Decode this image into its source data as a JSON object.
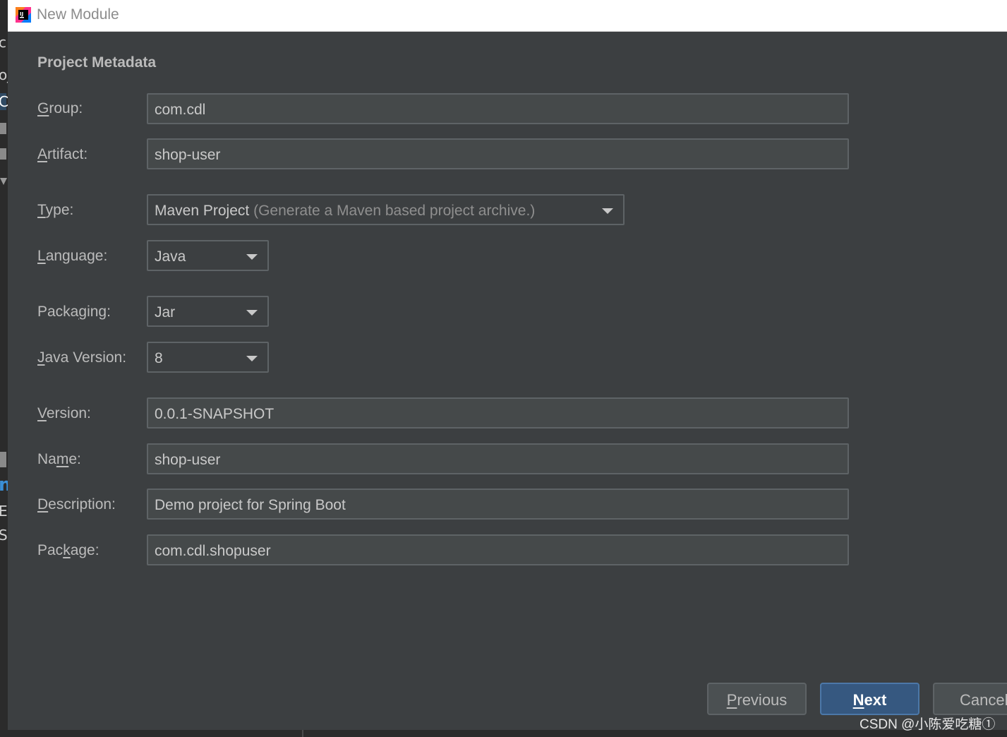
{
  "window": {
    "title": "New Module"
  },
  "background_ide": {
    "fragments": [
      "c",
      "oj",
      "C",
      "m",
      "Ex",
      "Sc"
    ]
  },
  "section": {
    "title": "Project Metadata"
  },
  "fields": {
    "group": {
      "label_mnemonic": "G",
      "label_rest": "roup:",
      "value": "com.cdl"
    },
    "artifact": {
      "label_mnemonic": "A",
      "label_rest": "rtifact:",
      "value": "shop-user"
    },
    "type": {
      "label_mnemonic": "T",
      "label_rest": "ype:",
      "value": "Maven Project",
      "hint": "(Generate a Maven based project archive.)"
    },
    "language": {
      "label_mnemonic": "L",
      "label_rest": "anguage:",
      "value": "Java"
    },
    "packaging": {
      "label_pre": "Packa",
      "label_mnemonic": "g",
      "label_rest": "ing:",
      "value": "Jar"
    },
    "java_version": {
      "label_mnemonic": "J",
      "label_rest": "ava Version:",
      "value": "8"
    },
    "version": {
      "label_mnemonic": "V",
      "label_rest": "ersion:",
      "value": "0.0.1-SNAPSHOT"
    },
    "name": {
      "label_pre": "Na",
      "label_mnemonic": "m",
      "label_rest": "e:",
      "value": "shop-user"
    },
    "description": {
      "label_mnemonic": "D",
      "label_rest": "escription:",
      "value": "Demo project for Spring Boot"
    },
    "package": {
      "label_pre": "Pac",
      "label_mnemonic": "k",
      "label_rest": "age:",
      "value": "com.cdl.shopuser"
    }
  },
  "buttons": {
    "previous": {
      "mnemonic": "P",
      "rest": "revious"
    },
    "next": {
      "mnemonic": "N",
      "rest": "ext"
    },
    "cancel": {
      "label": "Cancel"
    }
  },
  "watermark": "CSDN @小陈爱吃糖①",
  "colors": {
    "dialog_bg": "#3c3f41",
    "field_bg": "#45494a",
    "next_button": "#365880",
    "text": "#bbbbbb"
  }
}
